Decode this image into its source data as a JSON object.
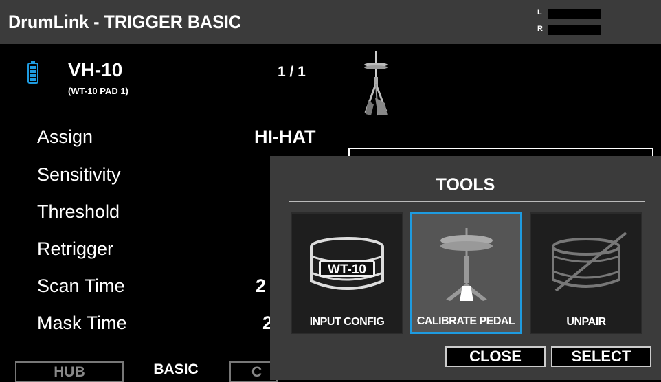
{
  "header": {
    "title": "DrumLink - TRIGGER BASIC",
    "meter_left_label": "L",
    "meter_right_label": "R"
  },
  "device": {
    "name": "VH-10",
    "subtitle": "(WT-10 PAD 1)",
    "page": "1 / 1",
    "battery_color": "#1e9be0",
    "image_icon": "hi-hat-stand-icon"
  },
  "params": [
    {
      "label": "Assign",
      "value": "HI-HAT"
    },
    {
      "label": "Sensitivity",
      "value": ""
    },
    {
      "label": "Threshold",
      "value": ""
    },
    {
      "label": "Retrigger",
      "value": ""
    },
    {
      "label": "Scan Time",
      "value": "2"
    },
    {
      "label": "Mask Time",
      "value": "2"
    }
  ],
  "tabs": [
    {
      "label": "HUB"
    },
    {
      "label": "BASIC"
    },
    {
      "label": "C"
    }
  ],
  "dialog": {
    "title": "TOOLS",
    "tools": [
      {
        "label": "INPUT CONFIG",
        "icon": "wt10-snare-icon",
        "badge": "WT-10"
      },
      {
        "label": "CALIBRATE PEDAL",
        "icon": "hi-hat-icon",
        "selected": true
      },
      {
        "label": "UNPAIR",
        "icon": "unpair-drum-icon"
      }
    ],
    "close_label": "CLOSE",
    "select_label": "SELECT",
    "accent_color": "#1e9be0"
  }
}
